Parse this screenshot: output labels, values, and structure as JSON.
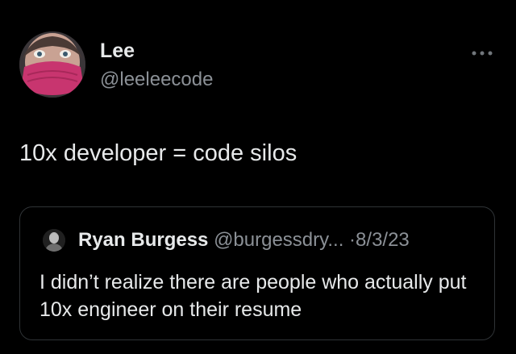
{
  "tweet": {
    "author": {
      "display_name": "Lee",
      "handle": "@leeleecode",
      "avatar_icon": "avatar-person-pink-mask"
    },
    "more_icon": "more-horizontal-icon",
    "text": "10x developer = code silos",
    "quoted_tweet": {
      "author": {
        "display_name": "Ryan Burgess",
        "handle": "@burgessdry...",
        "avatar_icon": "avatar-person"
      },
      "separator": "·",
      "date": "8/3/23",
      "text": "I didn’t realize there are people who actually put 10x engineer on their resume"
    }
  },
  "colors": {
    "background": "#000000",
    "primary_text": "#e7e9ea",
    "secondary_text": "#8b9096",
    "card_border": "#2f3336",
    "mask_pink": "#c8356f"
  }
}
